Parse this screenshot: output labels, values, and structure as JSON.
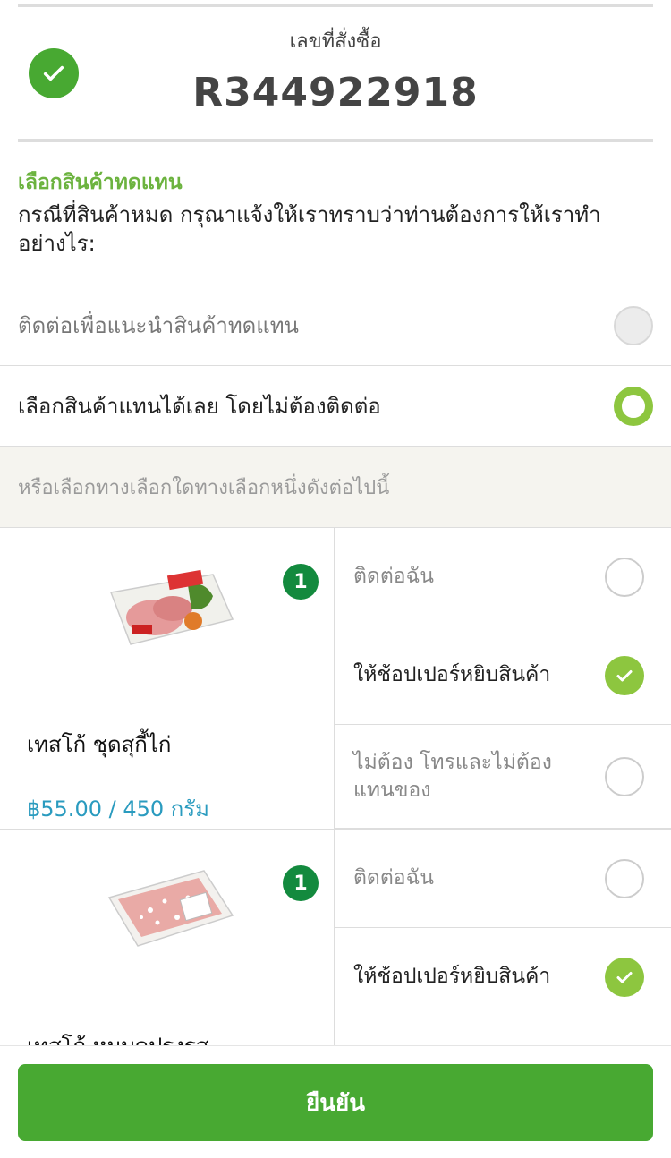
{
  "order": {
    "label": "เลขที่สั่งซื้อ",
    "number": "R344922918"
  },
  "substitution": {
    "title": "เลือกสินค้าทดแทน",
    "description": "กรณีที่สินค้าหมด กรุณาแจ้งให้เราทราบว่าท่านต้องการให้เราทำอย่างไร:",
    "options": [
      {
        "label": "ติดต่อเพื่อแนะนำสินค้าทดแทน",
        "state": "unselected"
      },
      {
        "label": "เลือกสินค้าแทนได้เลย โดยไม่ต้องติดต่อ",
        "state": "selected"
      }
    ],
    "hint": "หรือเลือกทางเลือกใดทางเลือกหนึ่งดังต่อไปนี้"
  },
  "products": [
    {
      "name": "เทสโก้ ชุดสุกี้ไก่",
      "price": "฿55.00 / 450 กรัม",
      "quantity": "1",
      "image_icon": "chicken-suki-pack-image",
      "options": [
        {
          "label": "ติดต่อฉัน",
          "state": "unchecked"
        },
        {
          "label": "ให้ช้อปเปอร์หยิบสินค้า",
          "state": "checked"
        },
        {
          "label": "ไม่ต้อง โทรและไม่ต้องแทนของ",
          "state": "unchecked"
        }
      ]
    },
    {
      "name": "เทสโก้ หมูบดปรุงรส",
      "quantity": "1",
      "image_icon": "minced-pork-pack-image",
      "options": [
        {
          "label": "ติดต่อฉัน",
          "state": "unchecked"
        },
        {
          "label": "ให้ช้อปเปอร์หยิบสินค้า",
          "state": "checked"
        }
      ]
    }
  ],
  "footer": {
    "confirm_label": "ยืนยัน"
  },
  "colors": {
    "primary_green": "#48a932",
    "light_green": "#8dc63f",
    "title_green": "#6cb33f",
    "price_blue": "#2a9bbf",
    "badge_green": "#138a3e"
  }
}
